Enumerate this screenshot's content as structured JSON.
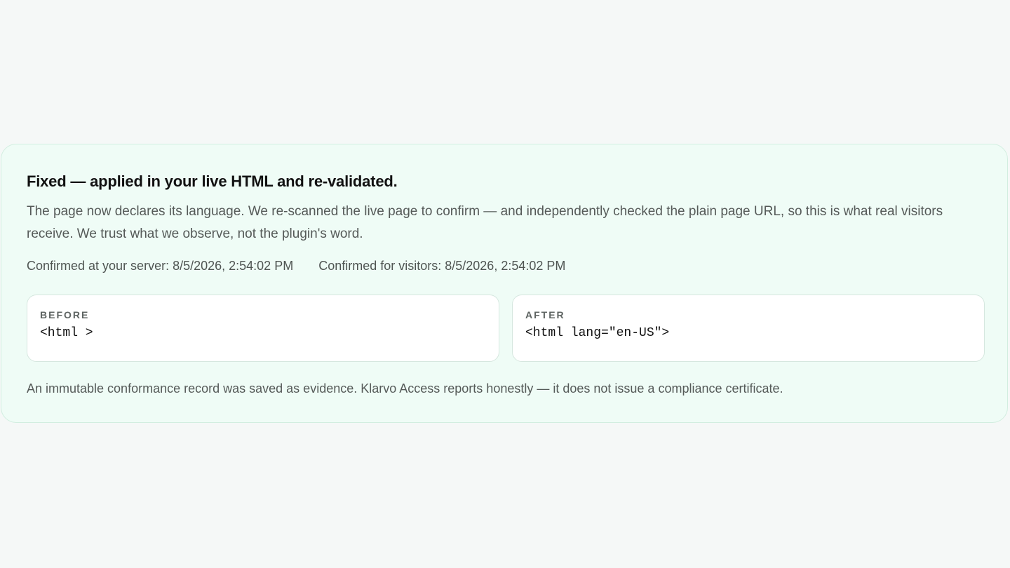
{
  "result": {
    "title": "Fixed — applied in your live HTML and re-validated.",
    "description": "The page now declares its language. We re-scanned the live page to confirm — and independently checked the plain page URL, so this is what real visitors receive. We trust what we observe, not the plugin's word.",
    "confirmed_server": "Confirmed at your server: 8/5/2026, 2:54:02 PM",
    "confirmed_visitors": "Confirmed for visitors: 8/5/2026, 2:54:02 PM",
    "before": {
      "label": "BEFORE",
      "code": "<html >"
    },
    "after": {
      "label": "AFTER",
      "code": "<html lang=\"en-US\">"
    },
    "footnote": "An immutable conformance record was saved as evidence. Klarvo Access reports honestly — it does not issue a compliance certificate."
  },
  "colors": {
    "page_background": "#f5f8f7",
    "card_background": "#effcf6",
    "card_border": "#d2eee0",
    "panel_background": "#ffffff"
  }
}
